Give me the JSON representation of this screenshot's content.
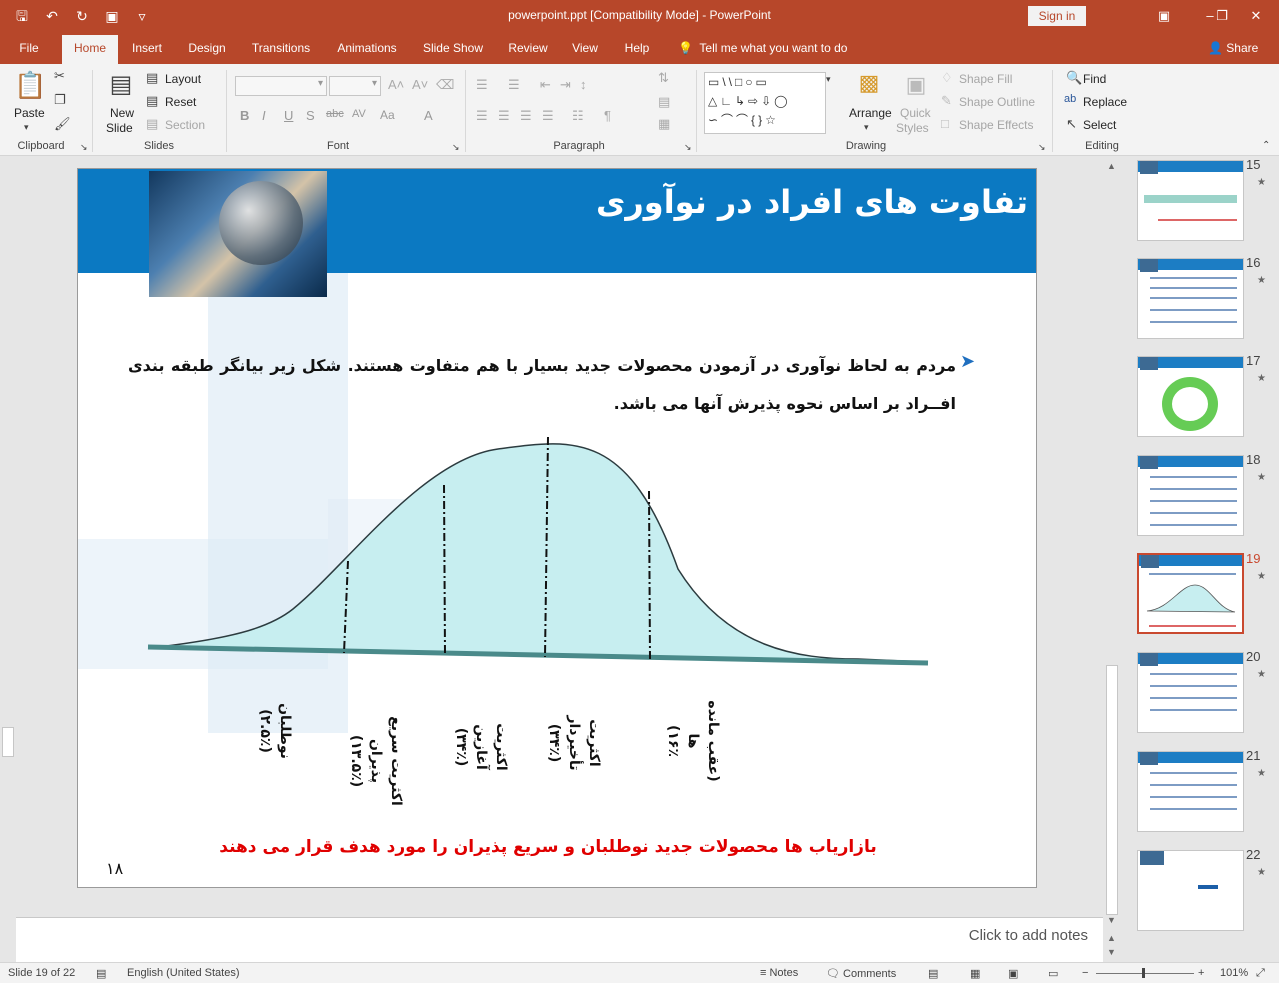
{
  "window": {
    "doc_title": "powerpoint.ppt [Compatibility Mode]  -  PowerPoint",
    "signin_label": "Sign in"
  },
  "tabs": [
    {
      "label": "File"
    },
    {
      "label": "Home"
    },
    {
      "label": "Insert"
    },
    {
      "label": "Design"
    },
    {
      "label": "Transitions"
    },
    {
      "label": "Animations"
    },
    {
      "label": "Slide Show"
    },
    {
      "label": "Review"
    },
    {
      "label": "View"
    },
    {
      "label": "Help"
    }
  ],
  "tell_me": "Tell me what you want to do",
  "share_label": "Share",
  "ribbon": {
    "clipboard": {
      "label": "Clipboard",
      "paste": "Paste"
    },
    "slides": {
      "label": "Slides",
      "new_slide_1": "New",
      "new_slide_2": "Slide",
      "layout": "Layout",
      "reset": "Reset",
      "section": "Section"
    },
    "font": {
      "label": "Font"
    },
    "paragraph": {
      "label": "Paragraph"
    },
    "drawing": {
      "label": "Drawing",
      "arrange": "Arrange",
      "quick_styles_1": "Quick",
      "quick_styles_2": "Styles",
      "shape_fill": "Shape Fill",
      "shape_outline": "Shape Outline",
      "shape_effects": "Shape Effects"
    },
    "editing": {
      "label": "Editing",
      "find": "Find",
      "replace": "Replace",
      "select": "Select"
    }
  },
  "slide": {
    "title": "تفاوت های افراد در نوآوری",
    "body": "مردم به لحاظ نوآوری در آزمودن محصولات جدید بسیار با هم متفاوت هستند. شکل زیر بیانگر طبقه بندی افــراد بر اساس نحوه پذیرش آنها می باشد.",
    "categories": [
      {
        "name": "نوطلبان",
        "pct": "(۲.۵٪)"
      },
      {
        "name": "اکثریت سریع پذیران",
        "pct": "(۱۳.۵٪)"
      },
      {
        "name": "اکثریت آغازین",
        "pct": "(۳۴٪)"
      },
      {
        "name": "اکثریت تأخیردار",
        "pct": "(۳۴٪)"
      },
      {
        "name": "(عقب مانده ها",
        "pct": "۱۶٪)"
      }
    ],
    "footer": "بازاریاب ها محصولات جدید نوطلبان و سریع پذیران را مورد هدف قرار می دهند",
    "number": "۱۸"
  },
  "notes_placeholder": "Click to add notes",
  "thumbnails": [
    {
      "num": "15"
    },
    {
      "num": "16"
    },
    {
      "num": "17"
    },
    {
      "num": "18"
    },
    {
      "num": "19"
    },
    {
      "num": "20"
    },
    {
      "num": "21"
    },
    {
      "num": "22"
    }
  ],
  "status": {
    "slide_info": "Slide 19 of 22",
    "language": "English (United States)",
    "notes": "Notes",
    "comments": "Comments",
    "zoom": "101%"
  },
  "colors": {
    "accent": "#b7472a",
    "slide_band": "#0b79c2",
    "curve_fill": "#c7eef0",
    "footer_text": "#e00000"
  }
}
